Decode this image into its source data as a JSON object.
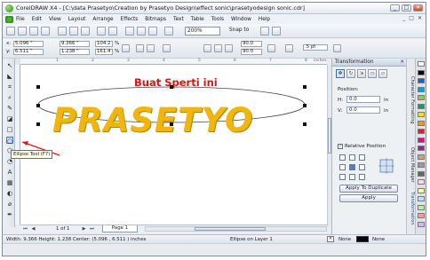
{
  "window": {
    "title": "CorelDRAW X4 - [C:\\data Prasetyo\\Creation by Prasetyo Design\\effect sonic\\prasetyodesign sonic.cdr]",
    "minimize": "_",
    "restore": "□",
    "close": "✕"
  },
  "menu": {
    "items": [
      "File",
      "Edit",
      "View",
      "Layout",
      "Arrange",
      "Effects",
      "Bitmaps",
      "Text",
      "Table",
      "Tools",
      "Window",
      "Help"
    ],
    "right_controls": [
      "_",
      "□",
      "✕"
    ]
  },
  "toolbar": {
    "zoom": "200%",
    "snap_to": "Snap to"
  },
  "property_bar": {
    "x": "5.096 \"",
    "y": "6.511 \"",
    "width": "9.366 \"",
    "height": "1.238 \"",
    "scale_w": "104.2",
    "scale_h": "161.4",
    "pct": "%",
    "angle1": "90.0",
    "angle2": "90.0",
    "outline": ".5 pt"
  },
  "ruler": {
    "unit": "inches",
    "ticks": [
      "1",
      "2",
      "3",
      "4",
      "5",
      "6",
      "7",
      "8"
    ]
  },
  "canvas": {
    "hint_text": "Buat Sperti ini",
    "logo_text": "PRASETYO"
  },
  "tooltip": "Ellipse Tool (F7)",
  "page_nav": {
    "count": "1 of 1",
    "tab": "Page 1"
  },
  "docker": {
    "title": "Transformation",
    "close": "✕",
    "position_label": "Position:",
    "h_label": "H:",
    "h_value": "0.0",
    "v_label": "V:",
    "v_value": "0.0",
    "unit": "in",
    "relative_label": "Relative Position",
    "apply_duplicate": "Apply To Duplicate",
    "apply": "Apply"
  },
  "side_tabs": [
    "Character Formatting",
    "Object Manager",
    "Transformation"
  ],
  "palette_colors": [
    "#ffffff",
    "#000000",
    "#1e5bd8",
    "#00a0e9",
    "#8ccf3a",
    "#00a651",
    "#ffde00",
    "#f7941d",
    "#ed1c24",
    "#ec008c",
    "#92278f",
    "#c7a27c",
    "#999999",
    "#666666",
    "#ffd6e7",
    "#ffff99",
    "#b7e4f7",
    "#c1e8b0",
    "#ff9a8f",
    "#d4b5ff"
  ],
  "status": {
    "dimensions": "Width: 9.366  Height: 1.238  Center: (5.096 , 6.511 )  inches",
    "layer": "Ellipse on Layer 1",
    "fill_none": "None",
    "fill_icon_label": "✕"
  }
}
